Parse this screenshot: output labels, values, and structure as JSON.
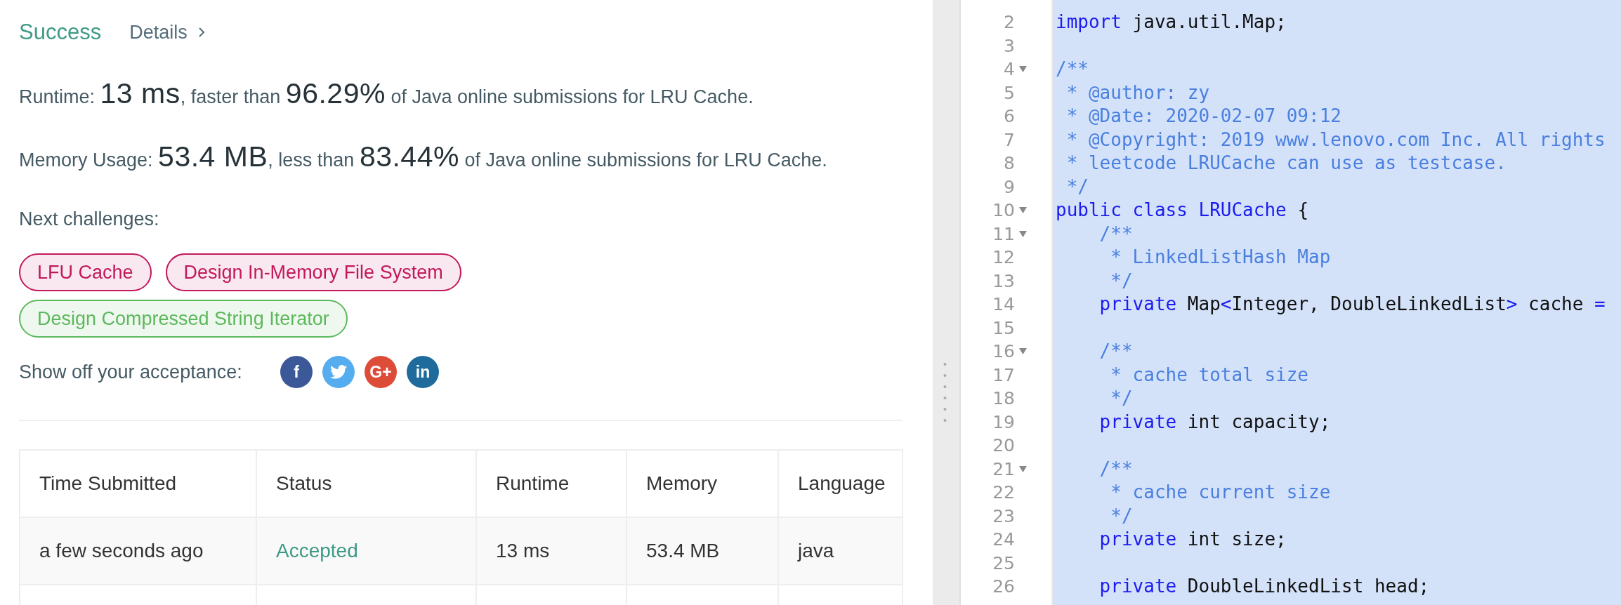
{
  "result": {
    "status": "Success",
    "details_link": "Details"
  },
  "runtime": {
    "label": "Runtime:",
    "value": "13 ms",
    "middle": ", faster than",
    "percent": "96.29%",
    "tail": "of Java online submissions for LRU Cache."
  },
  "memory": {
    "label": "Memory Usage:",
    "value": "53.4 MB",
    "middle": ", less than",
    "percent": "83.44%",
    "tail": "of Java online submissions for LRU Cache."
  },
  "next_challenges": {
    "label": "Next challenges:",
    "tags": [
      {
        "label": "LFU Cache",
        "color": "#c2185b"
      },
      {
        "label": "Design In-Memory File System",
        "color": "#c2185b"
      },
      {
        "label": "Design Compressed String Iterator",
        "color": "#5cb85c"
      }
    ]
  },
  "share": {
    "label": "Show off your acceptance:",
    "buttons": [
      {
        "kind": "text",
        "label": "f",
        "color": "#3b5998"
      },
      {
        "kind": "bird",
        "color": "#55acee"
      },
      {
        "kind": "text",
        "label": "G+",
        "color": "#dd4b39"
      },
      {
        "kind": "text",
        "label": "in",
        "color": "#1f6b9c"
      }
    ]
  },
  "table": {
    "columns": [
      "Time Submitted",
      "Status",
      "Runtime",
      "Memory",
      "Language"
    ],
    "rows": [
      {
        "time": "a few seconds ago",
        "status": {
          "text": "Accepted",
          "kind": "accepted"
        },
        "runtime": "13 ms",
        "memory": "53.4 MB",
        "language": "java"
      }
    ]
  },
  "editor": {
    "lines": [
      {
        "number": "2",
        "foldable": false,
        "segments": [
          {
            "kind": "keyword",
            "text": "import"
          },
          {
            "kind": "plain",
            "text": " java.util.Map;"
          }
        ]
      },
      {
        "number": "3",
        "foldable": false
      },
      {
        "number": "4",
        "foldable": true,
        "segments": [
          {
            "kind": "comment",
            "text": "/**"
          }
        ]
      },
      {
        "number": "5",
        "foldable": false,
        "segments": [
          {
            "kind": "comment",
            "text": " * @author: zy"
          }
        ]
      },
      {
        "number": "6",
        "foldable": false,
        "segments": [
          {
            "kind": "comment",
            "text": " * @Date: 2020-02-07 09:12"
          }
        ]
      },
      {
        "number": "7",
        "foldable": false,
        "segments": [
          {
            "kind": "comment",
            "text": " * @Copyright: 2019 www.lenovo.com Inc. All rights"
          }
        ]
      },
      {
        "number": "8",
        "foldable": false,
        "segments": [
          {
            "kind": "comment",
            "text": " * leetcode LRUCache can use as testcase."
          }
        ]
      },
      {
        "number": "9",
        "foldable": false,
        "segments": [
          {
            "kind": "comment",
            "text": " */"
          }
        ]
      },
      {
        "number": "10",
        "foldable": true,
        "segments": [
          {
            "kind": "keyword",
            "text": "public class LRUCache"
          },
          {
            "kind": "plain",
            "text": " {"
          }
        ]
      },
      {
        "number": "11",
        "foldable": true,
        "segments": [
          {
            "kind": "comment",
            "text": "    /**"
          }
        ]
      },
      {
        "number": "12",
        "foldable": false,
        "segments": [
          {
            "kind": "comment",
            "text": "     * LinkedListHash Map"
          }
        ]
      },
      {
        "number": "13",
        "foldable": false,
        "segments": [
          {
            "kind": "comment",
            "text": "     */"
          }
        ]
      },
      {
        "number": "14",
        "foldable": false,
        "segments": [
          {
            "kind": "keyword",
            "text": "    private"
          },
          {
            "kind": "plain",
            "text": " Map"
          },
          {
            "kind": "keyword",
            "text": "<"
          },
          {
            "kind": "plain",
            "text": "Integer, DoubleLinkedList"
          },
          {
            "kind": "keyword",
            "text": ">"
          },
          {
            "kind": "plain",
            "text": " cache "
          },
          {
            "kind": "keyword",
            "text": "="
          }
        ]
      },
      {
        "number": "15",
        "foldable": false
      },
      {
        "number": "16",
        "foldable": true,
        "segments": [
          {
            "kind": "comment",
            "text": "    /**"
          }
        ]
      },
      {
        "number": "17",
        "foldable": false,
        "segments": [
          {
            "kind": "comment",
            "text": "     * cache total size"
          }
        ]
      },
      {
        "number": "18",
        "foldable": false,
        "segments": [
          {
            "kind": "comment",
            "text": "     */"
          }
        ]
      },
      {
        "number": "19",
        "foldable": false,
        "segments": [
          {
            "kind": "keyword",
            "text": "    private"
          },
          {
            "kind": "plain",
            "text": " int capacity;"
          }
        ]
      },
      {
        "number": "20",
        "foldable": false
      },
      {
        "number": "21",
        "foldable": true,
        "segments": [
          {
            "kind": "comment",
            "text": "    /**"
          }
        ]
      },
      {
        "number": "22",
        "foldable": false,
        "segments": [
          {
            "kind": "comment",
            "text": "     * cache current size"
          }
        ]
      },
      {
        "number": "23",
        "foldable": false,
        "segments": [
          {
            "kind": "comment",
            "text": "     */"
          }
        ]
      },
      {
        "number": "24",
        "foldable": false,
        "segments": [
          {
            "kind": "keyword",
            "text": "    private"
          },
          {
            "kind": "plain",
            "text": " int size;"
          }
        ]
      },
      {
        "number": "25",
        "foldable": false
      },
      {
        "number": "26",
        "foldable": false,
        "segments": [
          {
            "kind": "keyword",
            "text": "    private"
          },
          {
            "kind": "plain",
            "text": " DoubleLinkedList head;"
          }
        ]
      }
    ]
  }
}
